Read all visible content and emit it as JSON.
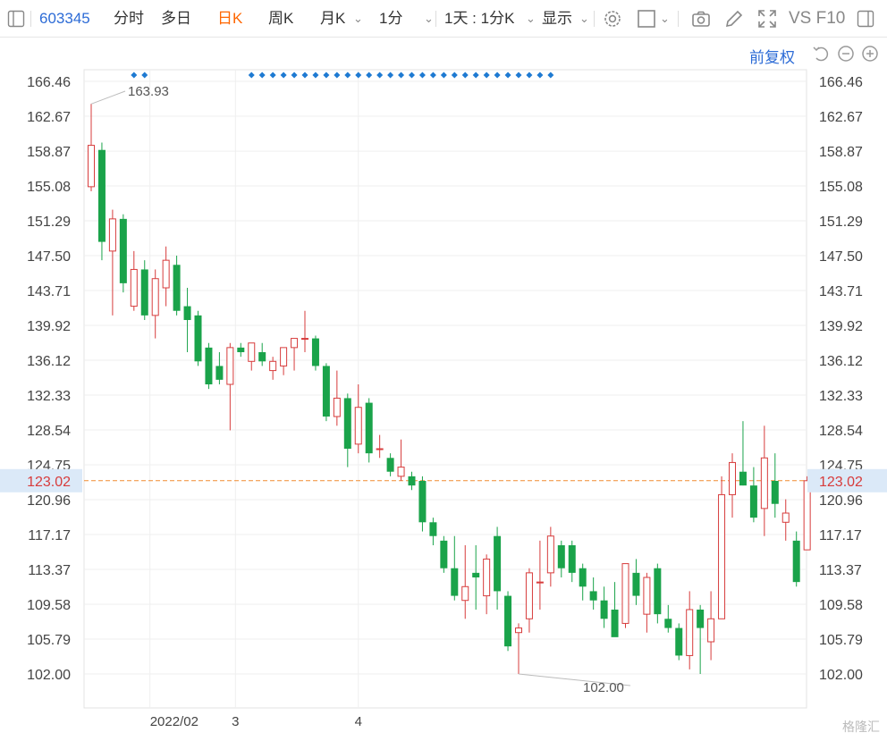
{
  "toolbar": {
    "code": "603345",
    "items": [
      "分时",
      "多日",
      "日K",
      "周K",
      "月K",
      "1分",
      "1天 : 1分K",
      "显示"
    ],
    "active": "日K",
    "right_text": "VS F10"
  },
  "subbar": {
    "adjust_label": "前复权"
  },
  "watermark": "格隆汇",
  "colors": {
    "up": "#d73c3c",
    "down": "#1aa34a",
    "accent_code": "#2c6bd6",
    "active_tab": "#ff6600",
    "price_line": "#f08c30",
    "current_bg": "#dbe9f8",
    "current_text": "#d73c3c",
    "marker": "#1e7ad2"
  },
  "chart_data": {
    "type": "candlestick",
    "y_ticks": [
      "166.46",
      "162.67",
      "158.87",
      "155.08",
      "151.29",
      "147.50",
      "143.71",
      "139.92",
      "136.12",
      "132.33",
      "128.54",
      "124.75",
      "120.96",
      "117.17",
      "113.37",
      "109.58",
      "105.79",
      "102.00"
    ],
    "ylim": [
      102.0,
      166.46
    ],
    "x_labels": [
      {
        "label": "2022/02",
        "index": 6
      },
      {
        "label": "3",
        "index": 14
      },
      {
        "label": "4",
        "index": 25.5
      }
    ],
    "current_price": "123.02",
    "high_annotation": {
      "label": "163.93",
      "index": 0
    },
    "low_annotation": {
      "label": "102.00",
      "index": 27
    },
    "marker_indices": [
      4,
      5,
      15,
      16,
      17,
      18,
      19,
      20,
      21,
      22,
      23,
      24,
      25,
      26,
      27,
      28,
      29,
      30,
      31,
      32,
      33,
      34,
      35,
      36,
      37,
      38,
      39,
      40,
      41,
      42,
      43
    ],
    "candles": [
      {
        "o": 155.0,
        "h": 164.0,
        "l": 154.5,
        "c": 159.5
      },
      {
        "o": 159.0,
        "h": 159.8,
        "l": 147.0,
        "c": 149.0
      },
      {
        "o": 148.0,
        "h": 152.5,
        "l": 141.0,
        "c": 151.5
      },
      {
        "o": 151.5,
        "h": 152.0,
        "l": 143.5,
        "c": 144.5
      },
      {
        "o": 142.0,
        "h": 148.0,
        "l": 141.5,
        "c": 146.0
      },
      {
        "o": 146.0,
        "h": 147.0,
        "l": 140.5,
        "c": 141.0
      },
      {
        "o": 141.0,
        "h": 146.0,
        "l": 138.5,
        "c": 145.0
      },
      {
        "o": 144.0,
        "h": 148.5,
        "l": 142.0,
        "c": 147.0
      },
      {
        "o": 146.5,
        "h": 147.5,
        "l": 141.0,
        "c": 141.5
      },
      {
        "o": 142.0,
        "h": 144.0,
        "l": 137.0,
        "c": 140.5
      },
      {
        "o": 141.0,
        "h": 141.5,
        "l": 135.5,
        "c": 136.0
      },
      {
        "o": 137.5,
        "h": 138.0,
        "l": 133.0,
        "c": 133.5
      },
      {
        "o": 135.5,
        "h": 137.0,
        "l": 133.5,
        "c": 134.0
      },
      {
        "o": 133.5,
        "h": 138.0,
        "l": 128.5,
        "c": 137.5
      },
      {
        "o": 137.5,
        "h": 138.0,
        "l": 136.5,
        "c": 137.0
      },
      {
        "o": 136.0,
        "h": 138.0,
        "l": 135.0,
        "c": 138.0
      },
      {
        "o": 137.0,
        "h": 138.0,
        "l": 135.5,
        "c": 136.0
      },
      {
        "o": 135.0,
        "h": 136.5,
        "l": 134.0,
        "c": 136.0
      },
      {
        "o": 135.5,
        "h": 137.5,
        "l": 134.5,
        "c": 137.5
      },
      {
        "o": 137.5,
        "h": 138.5,
        "l": 135.0,
        "c": 138.5
      },
      {
        "o": 138.5,
        "h": 141.5,
        "l": 137.0,
        "c": 138.5
      },
      {
        "o": 138.5,
        "h": 138.8,
        "l": 135.0,
        "c": 135.5
      },
      {
        "o": 135.5,
        "h": 135.8,
        "l": 129.5,
        "c": 130.0
      },
      {
        "o": 130.0,
        "h": 135.0,
        "l": 129.0,
        "c": 132.0
      },
      {
        "o": 132.0,
        "h": 132.5,
        "l": 124.5,
        "c": 126.5
      },
      {
        "o": 127.0,
        "h": 133.5,
        "l": 126.0,
        "c": 131.0
      },
      {
        "o": 131.5,
        "h": 132.0,
        "l": 125.0,
        "c": 126.0
      },
      {
        "o": 126.5,
        "h": 128.0,
        "l": 125.5,
        "c": 126.5
      },
      {
        "o": 125.5,
        "h": 126.0,
        "l": 123.5,
        "c": 124.0
      },
      {
        "o": 123.5,
        "h": 127.5,
        "l": 123.0,
        "c": 124.5
      },
      {
        "o": 123.5,
        "h": 124.0,
        "l": 122.0,
        "c": 122.5
      },
      {
        "o": 123.0,
        "h": 123.5,
        "l": 117.5,
        "c": 118.5
      },
      {
        "o": 118.5,
        "h": 119.0,
        "l": 116.0,
        "c": 117.0
      },
      {
        "o": 116.5,
        "h": 117.0,
        "l": 113.0,
        "c": 113.5
      },
      {
        "o": 113.5,
        "h": 117.0,
        "l": 110.0,
        "c": 110.5
      },
      {
        "o": 110.0,
        "h": 116.0,
        "l": 108.0,
        "c": 111.5
      },
      {
        "o": 113.0,
        "h": 116.0,
        "l": 109.0,
        "c": 112.5
      },
      {
        "o": 110.5,
        "h": 115.0,
        "l": 108.5,
        "c": 114.5
      },
      {
        "o": 117.0,
        "h": 118.0,
        "l": 109.0,
        "c": 111.0
      },
      {
        "o": 110.5,
        "h": 111.0,
        "l": 104.5,
        "c": 105.0
      },
      {
        "o": 106.5,
        "h": 107.5,
        "l": 102.0,
        "c": 107.0
      },
      {
        "o": 108.0,
        "h": 113.5,
        "l": 106.5,
        "c": 113.0
      },
      {
        "o": 112.0,
        "h": 116.5,
        "l": 109.0,
        "c": 112.0
      },
      {
        "o": 113.0,
        "h": 118.0,
        "l": 111.5,
        "c": 117.0
      },
      {
        "o": 116.0,
        "h": 116.5,
        "l": 112.5,
        "c": 113.5
      },
      {
        "o": 116.0,
        "h": 116.5,
        "l": 112.0,
        "c": 113.0
      },
      {
        "o": 113.5,
        "h": 114.0,
        "l": 110.0,
        "c": 111.5
      },
      {
        "o": 111.0,
        "h": 112.5,
        "l": 109.0,
        "c": 110.0
      },
      {
        "o": 110.0,
        "h": 111.5,
        "l": 107.0,
        "c": 108.0
      },
      {
        "o": 109.0,
        "h": 112.0,
        "l": 106.5,
        "c": 106.0
      },
      {
        "o": 107.5,
        "h": 114.0,
        "l": 107.0,
        "c": 114.0
      },
      {
        "o": 113.0,
        "h": 114.5,
        "l": 109.5,
        "c": 110.5
      },
      {
        "o": 108.5,
        "h": 113.0,
        "l": 106.5,
        "c": 112.5
      },
      {
        "o": 113.5,
        "h": 114.0,
        "l": 107.5,
        "c": 108.5
      },
      {
        "o": 108.0,
        "h": 109.5,
        "l": 106.5,
        "c": 107.0
      },
      {
        "o": 107.0,
        "h": 107.5,
        "l": 103.5,
        "c": 104.0
      },
      {
        "o": 104.0,
        "h": 111.0,
        "l": 102.5,
        "c": 109.0
      },
      {
        "o": 109.0,
        "h": 109.5,
        "l": 102.0,
        "c": 107.0
      },
      {
        "o": 105.5,
        "h": 111.0,
        "l": 103.5,
        "c": 108.0
      },
      {
        "o": 108.0,
        "h": 123.5,
        "l": 108.0,
        "c": 121.5
      },
      {
        "o": 121.5,
        "h": 126.0,
        "l": 119.0,
        "c": 125.0
      },
      {
        "o": 124.0,
        "h": 129.5,
        "l": 122.5,
        "c": 122.5
      },
      {
        "o": 122.5,
        "h": 124.5,
        "l": 118.5,
        "c": 119.0
      },
      {
        "o": 120.0,
        "h": 129.0,
        "l": 117.0,
        "c": 125.5
      },
      {
        "o": 123.0,
        "h": 126.0,
        "l": 119.0,
        "c": 120.5
      },
      {
        "o": 118.5,
        "h": 121.0,
        "l": 116.5,
        "c": 119.5
      },
      {
        "o": 116.5,
        "h": 117.5,
        "l": 111.5,
        "c": 112.0
      },
      {
        "o": 115.5,
        "h": 123.5,
        "l": 115.5,
        "c": 123.02
      }
    ]
  }
}
